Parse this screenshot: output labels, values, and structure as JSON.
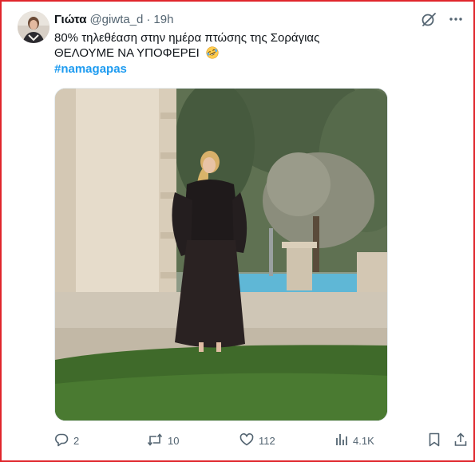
{
  "tweet": {
    "display_name": "Γιώτα",
    "handle": "@giwta_d",
    "separator": "·",
    "time": "19h",
    "text_line1": "80% τηλεθέαση στην ημέρα πτώσης της Σοράγιας",
    "text_line2": "ΘΕΛΟΥΜΕ ΝΑ ΥΠΟΦΕΡΕΙ",
    "emoji": "rolling-on-the-floor-laughing",
    "hashtag": "#namagapas"
  },
  "header_icons": [
    "grok-icon",
    "more-icon"
  ],
  "actions": {
    "replies": "2",
    "reposts": "10",
    "likes": "112",
    "views": "4.1K"
  },
  "colors": {
    "frame": "#e0252b",
    "hashtag": "#1d9bf0",
    "secondary_text": "#536471",
    "primary_text": "#0f1419"
  }
}
